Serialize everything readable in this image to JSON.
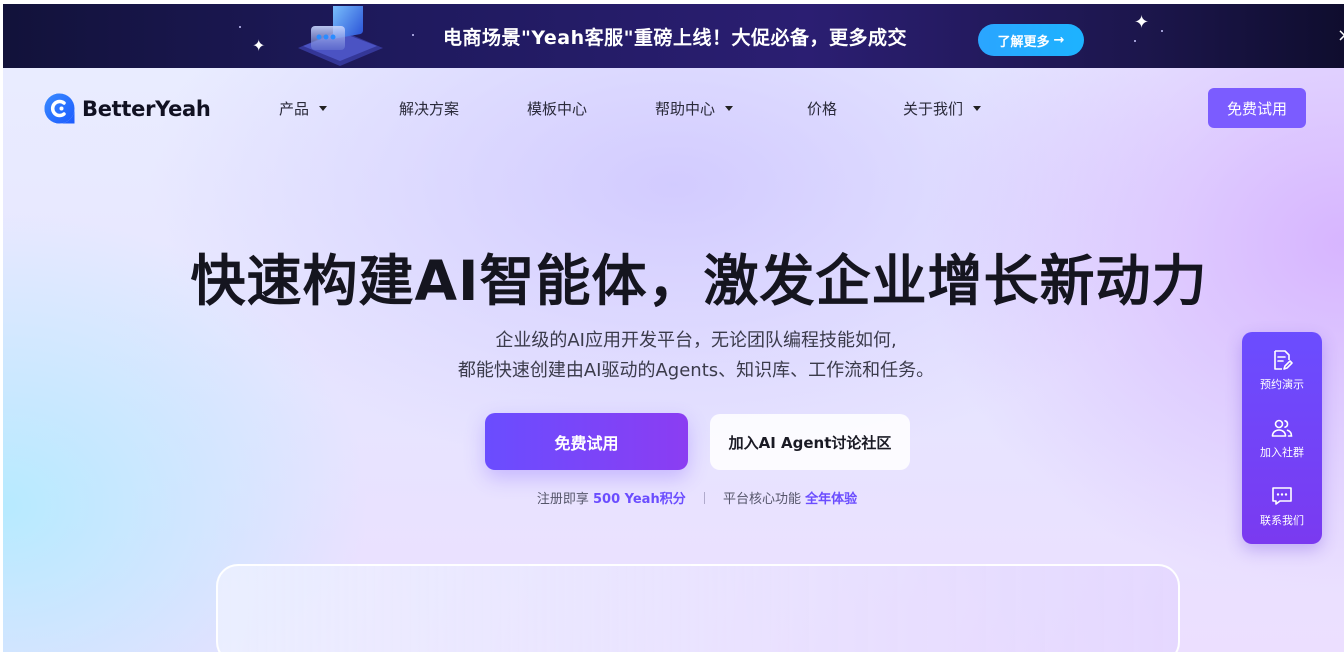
{
  "banner": {
    "text": "电商场景\"Yeah客服\"重磅上线！大促必备，更多成交",
    "button_label": "了解更多",
    "button_arrow": "→",
    "close_icon": "×"
  },
  "nav": {
    "logo_text": "BetterYeah",
    "items": [
      {
        "label": "产品",
        "has_caret": true
      },
      {
        "label": "解决方案",
        "has_caret": false
      },
      {
        "label": "模板中心",
        "has_caret": false
      },
      {
        "label": "帮助中心",
        "has_caret": true
      },
      {
        "label": "价格",
        "has_caret": false
      },
      {
        "label": "关于我们",
        "has_caret": true
      }
    ],
    "cta_label": "免费试用"
  },
  "hero": {
    "headline": "快速构建AI智能体，激发企业增长新动力",
    "subline_1": "企业级的AI应用开发平台，无论团队编程技能如何,",
    "subline_2": "都能快速创建由AI驱动的Agents、知识库、工作流和任务。",
    "primary_button": "免费试用",
    "secondary_button": "加入AI Agent讨论社区",
    "perk_1_prefix": "注册即享",
    "perk_1_highlight": "500 Yeah积分",
    "perk_2_prefix": "平台核心功能",
    "perk_2_highlight": "全年体验"
  },
  "side_panel": {
    "items": [
      {
        "label": "预约演示",
        "icon": "edit-document-icon"
      },
      {
        "label": "加入社群",
        "icon": "users-icon"
      },
      {
        "label": "联系我们",
        "icon": "chat-bubble-icon"
      }
    ]
  },
  "colors": {
    "brand": "#7b5cff",
    "banner_bg": "#1f1a5e",
    "banner_button": "#1db3ff",
    "highlight": "#6b4dff"
  }
}
